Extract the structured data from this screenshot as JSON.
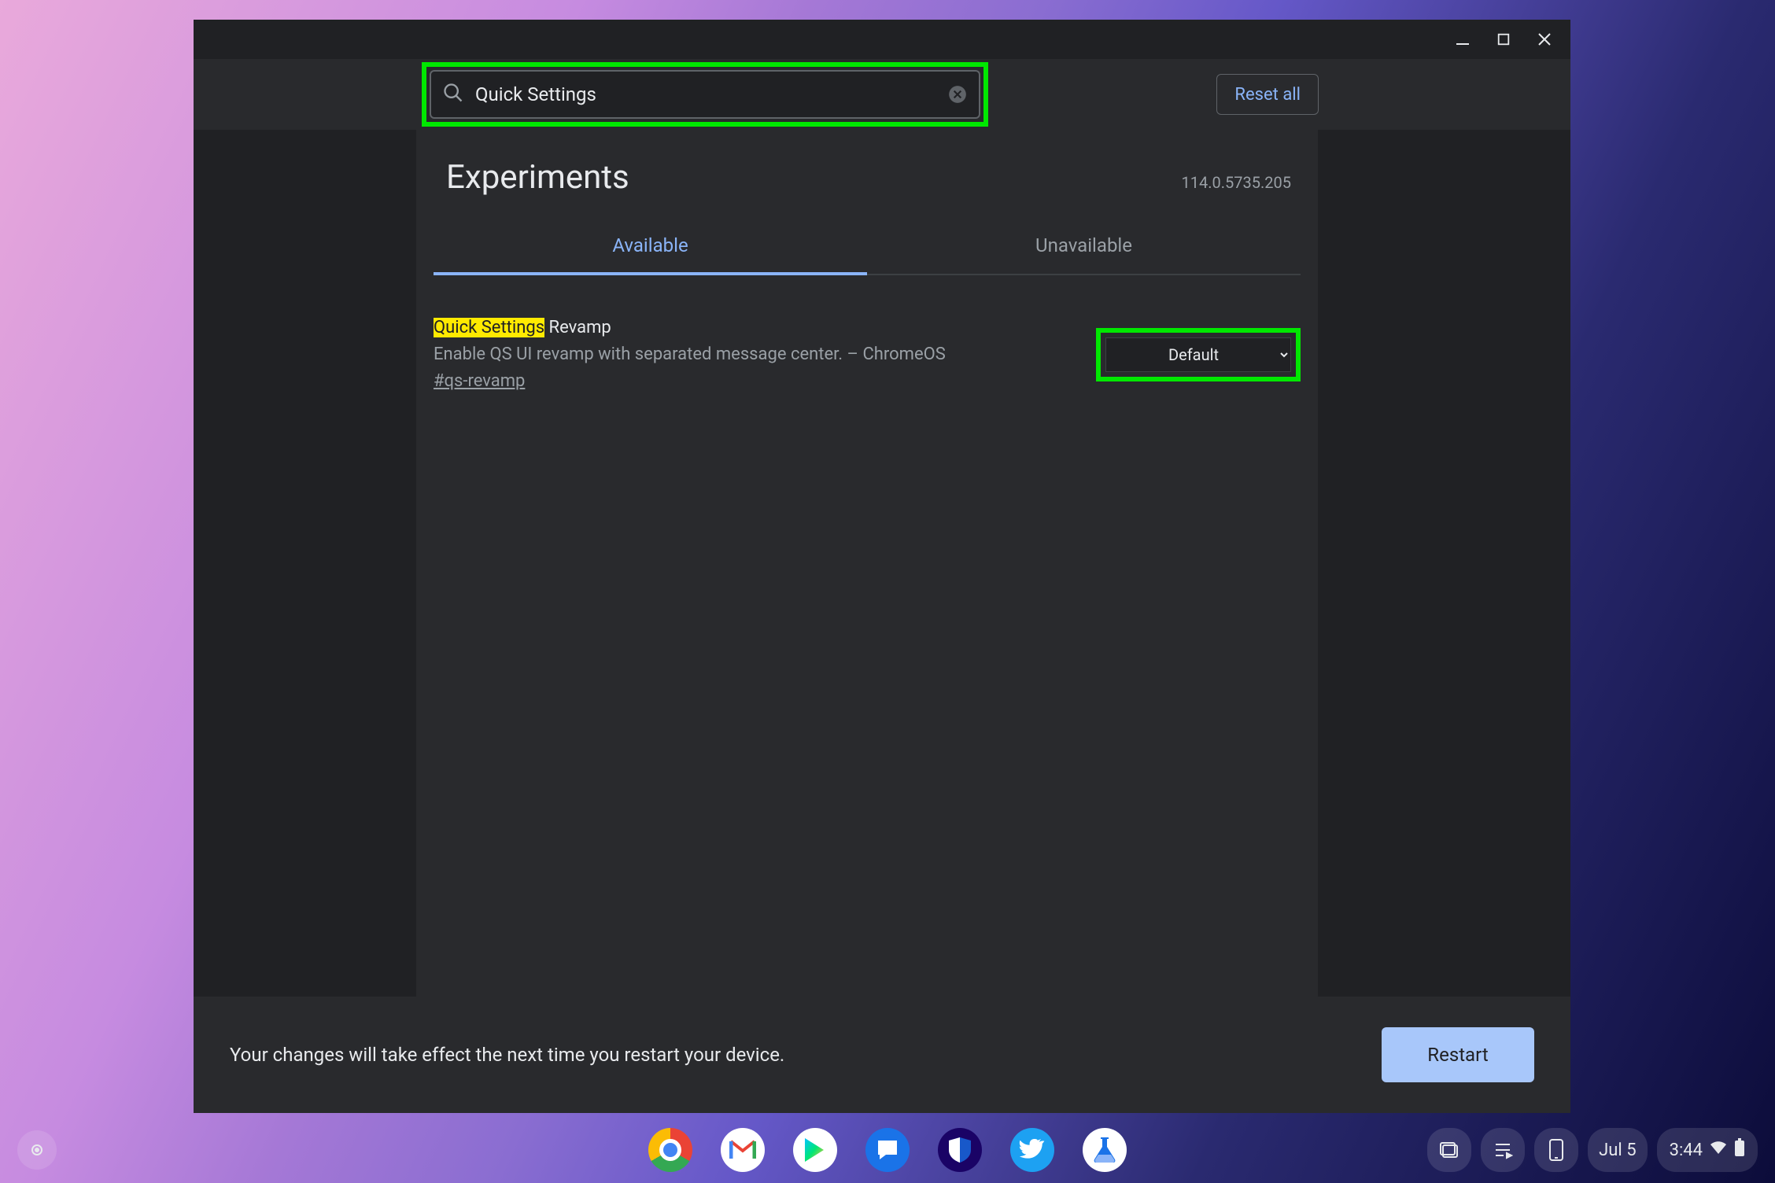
{
  "window": {
    "title": "Experiments"
  },
  "toolbar": {
    "search_value": "Quick Settings",
    "reset_label": "Reset all"
  },
  "header": {
    "title": "Experiments",
    "version": "114.0.5735.205"
  },
  "tabs": {
    "available": "Available",
    "unavailable": "Unavailable",
    "active": "available"
  },
  "flag": {
    "title_hl": "Quick Settings",
    "title_rest": " Revamp",
    "description": "Enable QS UI revamp with separated message center. – ChromeOS",
    "link": "#qs-revamp",
    "select_value": "Default"
  },
  "footer": {
    "message": "Your changes will take effect the next time you restart your device.",
    "restart": "Restart"
  },
  "shelf": {
    "apps": [
      "chrome",
      "gmail",
      "play-store",
      "messages",
      "bitwarden",
      "twitter",
      "flask"
    ],
    "date": "Jul 5",
    "time": "3:44"
  }
}
